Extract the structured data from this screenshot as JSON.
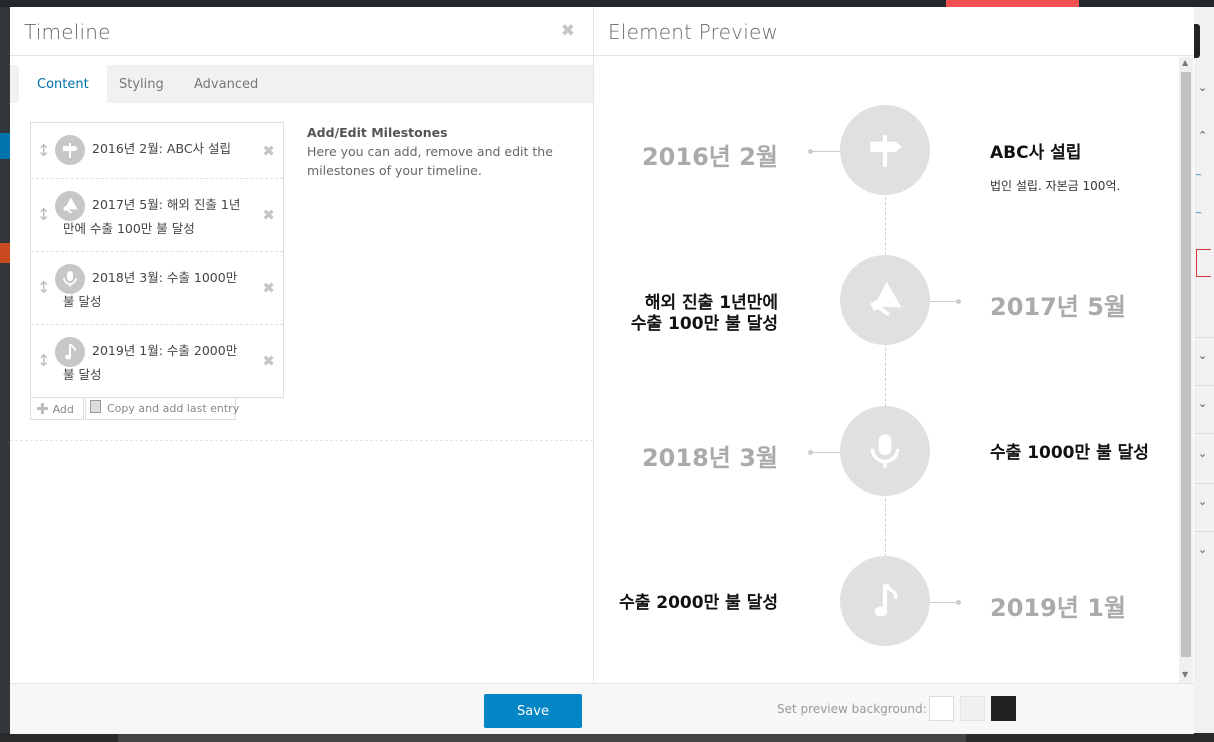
{
  "left_title": "Timeline",
  "right_title": "Element Preview",
  "tabs": [
    {
      "label": "Content",
      "active": true
    },
    {
      "label": "Styling",
      "active": false
    },
    {
      "label": "Advanced",
      "active": false
    }
  ],
  "milestones": [
    {
      "text": "2016년 2월: ABC사 설립",
      "icon": "signpost-icon"
    },
    {
      "text": "2017년 5월: 해외 진출 1년만에 수출 100만 불 달성",
      "icon": "megaphone-icon"
    },
    {
      "text": "2018년 3월: 수출 1000만 불 달성",
      "icon": "microphone-icon"
    },
    {
      "text": "2019년 1월: 수출 2000만 불 달성",
      "icon": "music-note-icon"
    }
  ],
  "add_label": "Add",
  "copy_label": "Copy and add last entry",
  "help": {
    "heading": "Add/Edit Milestones",
    "body": "Here you can add, remove and edit the milestones of your timeline."
  },
  "save_label": "Save",
  "bg_label": "Set preview background:",
  "swatches": [
    "#ffffff",
    "#f0f0f0",
    "#222222"
  ],
  "preview": {
    "m1": {
      "date": "2016년 2월",
      "title": "ABC사 설립",
      "desc": "법인 설립. 자본금 100억."
    },
    "m2": {
      "date": "2017년 5월",
      "title_l1": "해외 진출 1년만에",
      "title_l2": "수출 100만 불 달성"
    },
    "m3": {
      "date": "2018년 3월",
      "title": "수출 1000만 불 달성"
    },
    "m4": {
      "date": "2019년 1월",
      "title": "수출 2000만 불 달성"
    }
  },
  "colors": {
    "accent": "#0073aa",
    "save": "#0485c5",
    "circle": "#e0e0e0"
  }
}
